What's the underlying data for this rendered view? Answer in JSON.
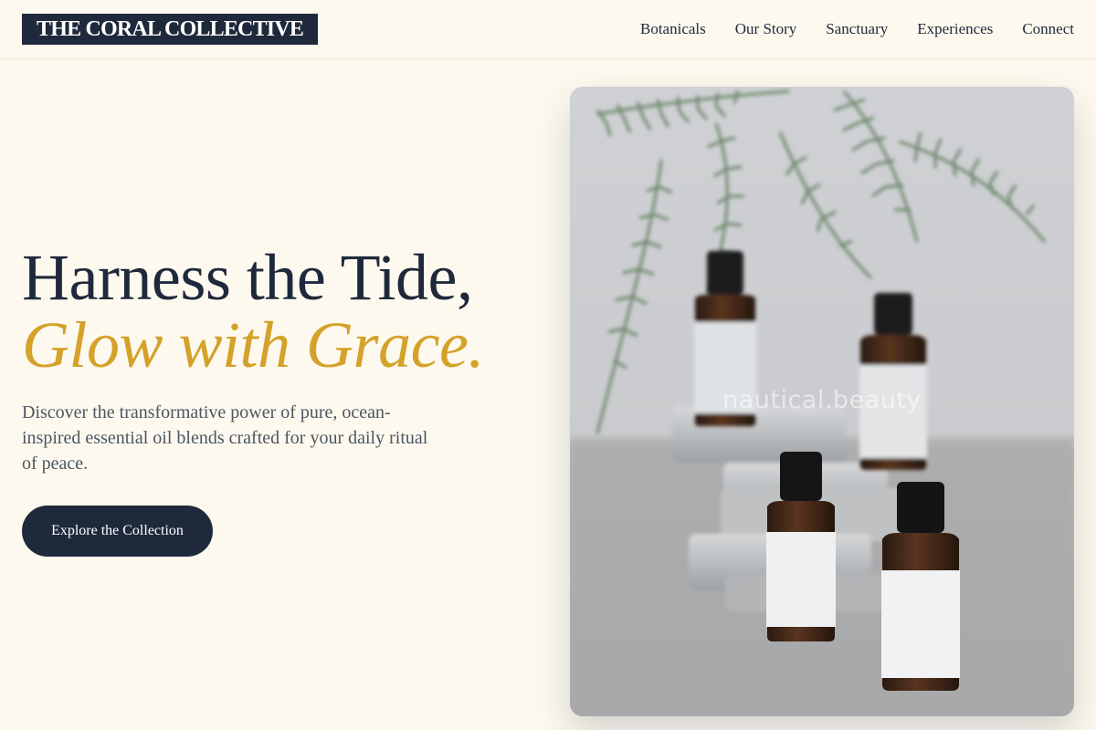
{
  "brand": {
    "name": "THE CORAL COLLECTIVE"
  },
  "nav": {
    "items": [
      {
        "label": "Botanicals"
      },
      {
        "label": "Our Story"
      },
      {
        "label": "Sanctuary"
      },
      {
        "label": "Experiences"
      },
      {
        "label": "Connect"
      }
    ]
  },
  "hero": {
    "headline_line1": "Harness the Tide,",
    "headline_line2": "Glow with Grace.",
    "lead": "Discover the transformative power of pure, ocean-inspired essential oil blends crafted for your daily ritual of peace.",
    "cta_label": "Explore the Collection",
    "image": {
      "subject": "essential-oil-bottles-with-fern-photo",
      "watermark": "nautical.beauty"
    }
  },
  "colors": {
    "background": "#fdf9ee",
    "navy": "#1e293b",
    "gold": "#d4a22a",
    "body_text": "#4b5563"
  }
}
